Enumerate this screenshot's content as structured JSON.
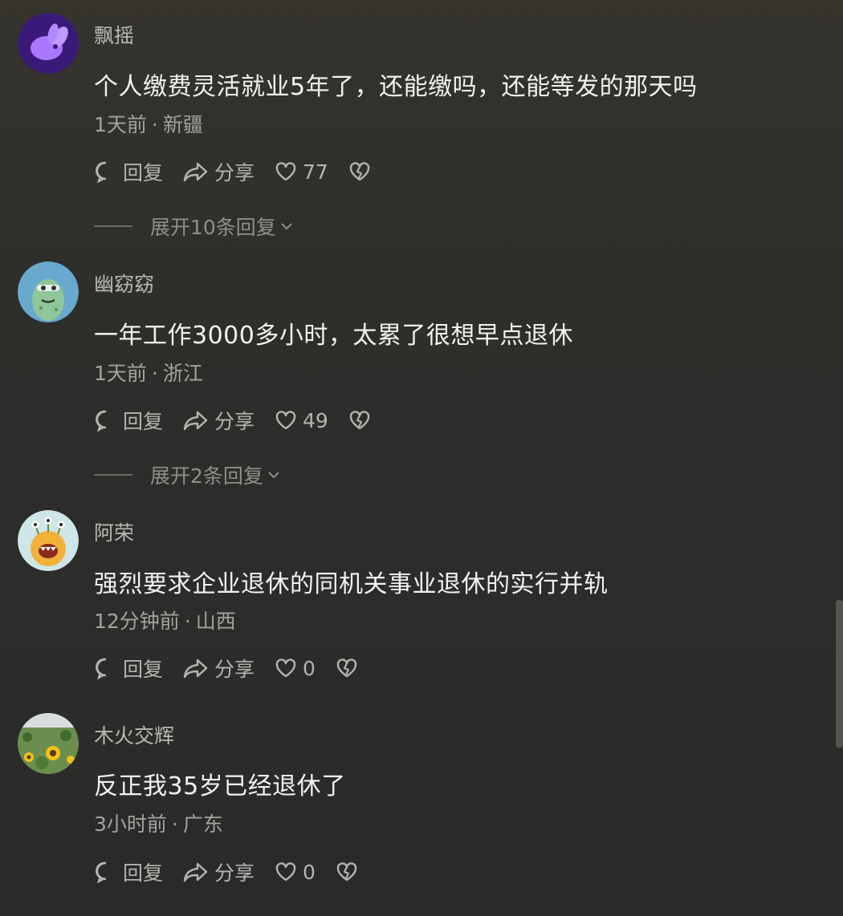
{
  "comments": [
    {
      "username": "飘摇",
      "avatar": "purple-rabbit-avatar",
      "text": "个人缴费灵活就业5年了，还能缴吗，还能等发的那天吗",
      "time": "1天前",
      "location": "新疆",
      "reply_label": "回复",
      "share_label": "分享",
      "likes": "77",
      "expand_label": "展开10条回复"
    },
    {
      "username": "幽窈窈",
      "avatar": "green-cartoon-avatar",
      "text": "一年工作3000多小时，太累了很想早点退休",
      "time": "1天前",
      "location": "浙江",
      "reply_label": "回复",
      "share_label": "分享",
      "likes": "49",
      "expand_label": "展开2条回复"
    },
    {
      "username": "阿荣",
      "avatar": "yellow-monster-avatar",
      "text": "强烈要求企业退休的同机关事业退休的实行并轨",
      "time": "12分钟前",
      "location": "山西",
      "reply_label": "回复",
      "share_label": "分享",
      "likes": "0"
    },
    {
      "username": "木火交辉",
      "avatar": "sunflower-field-avatar",
      "text": "反正我35岁已经退休了",
      "time": "3小时前",
      "location": "广东",
      "reply_label": "回复",
      "share_label": "分享",
      "likes": "0"
    }
  ],
  "meta_separator": "·",
  "colors": {
    "background": "#2f2e2b",
    "username": "#b9b8b3",
    "text": "#f2f2f0",
    "meta": "#a3a29d"
  }
}
